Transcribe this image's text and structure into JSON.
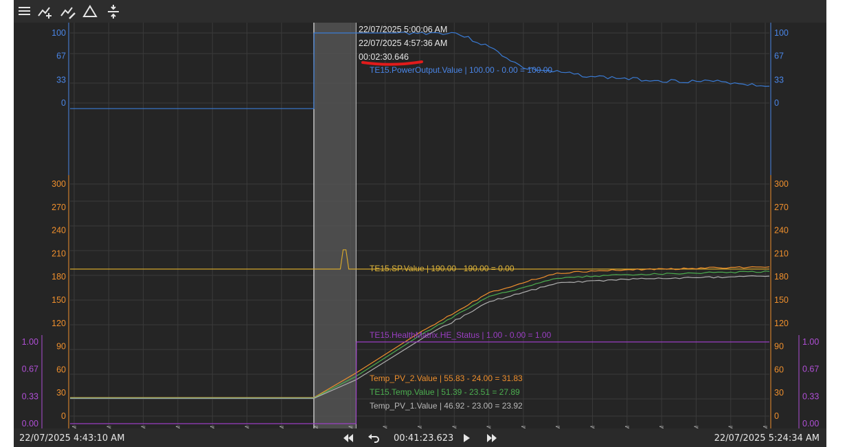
{
  "toolbar": {
    "icons": [
      "menu-icon",
      "add-trend-icon",
      "edit-trend-icon",
      "delta-icon",
      "split-axes-icon"
    ]
  },
  "colors": {
    "background": "#252525",
    "grid": "#3a3a3a",
    "power": "#3a7bd5",
    "setpoint": "#d4a72c",
    "temp_pv2": "#f0902d",
    "te15_temp": "#4caf50",
    "temp_pv1": "#b0b0b0",
    "health": "#9b3fc4",
    "orange_axis": "#f0902d",
    "blue_axis": "#4a86e8",
    "purple_axis": "#b04fd6",
    "cursor_band": "#5a5a5a",
    "annotation_red": "#e11b1b"
  },
  "cursor": {
    "time_end": "22/07/2025 5:00:06 AM",
    "time_start": "22/07/2025 4:57:36 AM",
    "duration": "00:02:30.646"
  },
  "axes": {
    "blue_ticks": [
      "100",
      "67",
      "33",
      "0"
    ],
    "orange_ticks": [
      "300",
      "270",
      "240",
      "210",
      "180",
      "150",
      "120",
      "90",
      "60",
      "30",
      "0"
    ],
    "purple_ticks": [
      "1.00",
      "0.67",
      "0.33",
      "0.00"
    ],
    "time_ticks": [
      "4:43:41 AM",
      "4:45:43 AM",
      "4:47:46 AM",
      "4:49:48 AM",
      "4:51:50 AM",
      "4:53:52 AM",
      "4:55:55 AM",
      "4:57:57 AM",
      "4:59:59 AM",
      "5:02:01 AM",
      "5:04:03 AM",
      "5:06:06 AM",
      "5:08:08 AM",
      "5:10:10 AM",
      "5:12:11 AM",
      "5:14:14 AM",
      "5:16:16 AM",
      "5:18:18 AM",
      "5:20:20 AM",
      "5:22:22 AM",
      "5:24:24 AM"
    ]
  },
  "series_labels": {
    "power": "TE15.PowerOutput.Value | 100.00 - 0.00 = 100.00",
    "setpoint": "TE15.SP.Value | 190.00 - 190.00 = 0.00",
    "health": "TE15.HealthMatrix.HE_Status | 1.00 - 0.00 = 1.00",
    "temp_pv2": "Temp_PV_2.Value | 55.83 - 24.00 = 31.83",
    "te15_temp": "TE15.Temp.Value | 51.39 - 23.51 = 27.89",
    "temp_pv1": "Temp_PV_1.Value | 46.92 - 23.00 = 23.92"
  },
  "chart_data": {
    "type": "line",
    "x_range": [
      "4:43:10 AM",
      "5:24:34 AM"
    ],
    "series": [
      {
        "name": "TE15.PowerOutput.Value",
        "axis": "blue",
        "x": [
          "4:43:10",
          "4:57:36",
          "4:57:37",
          "5:00:06",
          "5:02:30",
          "5:06:00",
          "5:08:00",
          "5:10:00",
          "5:14:00",
          "5:18:00",
          "5:22:00",
          "5:24:34"
        ],
        "values": [
          -8,
          -8,
          100,
          100,
          100,
          100,
          80,
          50,
          38,
          32,
          30,
          24
        ]
      },
      {
        "name": "TE15.SP.Value",
        "axis": "orange",
        "x": [
          "4:43:10",
          "4:59:10",
          "4:59:20",
          "4:59:30",
          "4:59:40",
          "5:24:34"
        ],
        "values": [
          190,
          190,
          215,
          215,
          190,
          190
        ]
      },
      {
        "name": "Temp_PV_2.Value",
        "axis": "orange",
        "x": [
          "4:43:10",
          "4:57:36",
          "5:00:06",
          "5:04:00",
          "5:08:00",
          "5:12:00",
          "5:16:00",
          "5:20:00",
          "5:24:34"
        ],
        "values": [
          24,
          24,
          55.83,
          110,
          160,
          185,
          189,
          191,
          193
        ]
      },
      {
        "name": "TE15.Temp.Value",
        "axis": "orange",
        "x": [
          "4:43:10",
          "4:57:36",
          "5:00:06",
          "5:04:00",
          "5:08:00",
          "5:12:00",
          "5:16:00",
          "5:20:00",
          "5:24:34"
        ],
        "values": [
          23.51,
          23.51,
          51.39,
          106,
          155,
          178,
          183,
          185,
          187
        ]
      },
      {
        "name": "Temp_PV_1.Value",
        "axis": "orange",
        "x": [
          "4:43:10",
          "4:57:36",
          "5:00:06",
          "5:04:00",
          "5:08:00",
          "5:12:00",
          "5:16:00",
          "5:20:00",
          "5:24:34"
        ],
        "values": [
          23,
          23,
          46.92,
          100,
          148,
          172,
          177,
          179,
          181
        ]
      },
      {
        "name": "TE15.HealthMatrix.HE_Status",
        "axis": "purple",
        "x": [
          "4:43:10",
          "5:00:06",
          "5:00:07",
          "5:24:34"
        ],
        "values": [
          0,
          0,
          1,
          1
        ]
      }
    ],
    "axis_ranges": {
      "blue": [
        0,
        100
      ],
      "orange": [
        0,
        300
      ],
      "purple": [
        0,
        1
      ]
    },
    "grid": true
  },
  "bottom": {
    "start_time": "22/07/2025  4:43:10 AM",
    "span": "00:41:23.623",
    "end_time": "22/07/2025  5:24:34 AM"
  }
}
